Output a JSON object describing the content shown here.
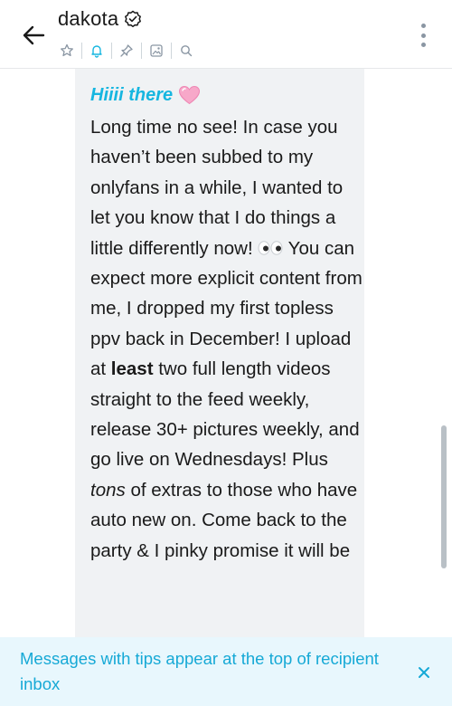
{
  "header": {
    "title": "dakota",
    "icons": [
      "star-icon",
      "bell-icon",
      "pin-icon",
      "media-icon",
      "search-icon"
    ]
  },
  "message": {
    "greeting": "Hiiii there",
    "line1": "Long time no see! In case you haven’t been subbed to my onlyfans in a while, I wanted to let you know that I do things a little differently now! ",
    "line2": " You can expect more explicit content from me, I dropped my first topless ppv back in December! I upload at ",
    "bold1": "least",
    "line3": " two full length videos straight to the feed weekly, release 30+ pictures weekly, and go live on Wednesdays! Plus ",
    "italic1": "tons",
    "line4": " of extras to those who have auto new on. Come back to the party & I pinky promise it will be"
  },
  "banner": {
    "text": "Messages with tips appear at the top of recipient inbox"
  },
  "colors": {
    "accent": "#16b6e0",
    "bubble": "#f0f2f4",
    "banner_bg": "#e8f7fd"
  }
}
